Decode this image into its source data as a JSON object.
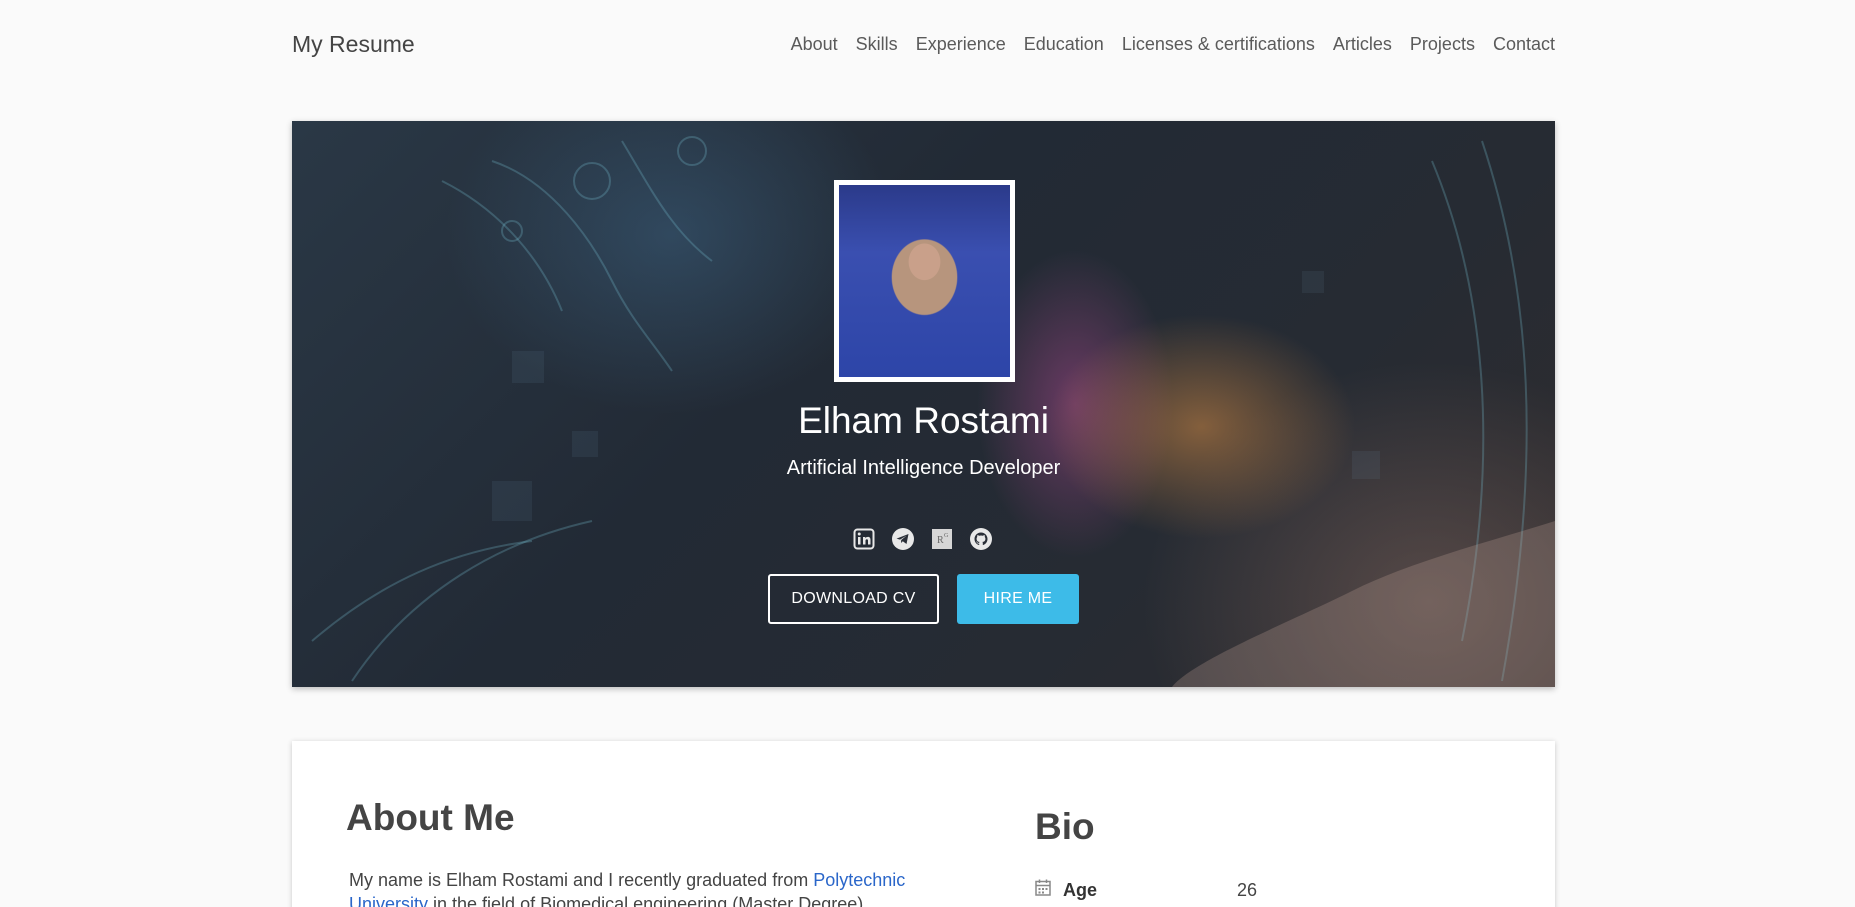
{
  "header": {
    "brand": "My Resume",
    "nav": [
      "About",
      "Skills",
      "Experience",
      "Education",
      "Licenses & certifications",
      "Articles",
      "Projects",
      "Contact"
    ]
  },
  "hero": {
    "name": "Elham Rostami",
    "title": "Artificial Intelligence Developer",
    "socials": [
      "linkedin-icon",
      "telegram-icon",
      "researchgate-icon",
      "github-icon"
    ],
    "download_label": "DOWNLOAD CV",
    "hire_label": "HIRE ME"
  },
  "about": {
    "title": "About Me",
    "text_before": "My name is Elham Rostami and I recently graduated from ",
    "link_text": "Polytechnic University",
    "text_after": " in the field of Biomedical engineering (Master Degree)"
  },
  "bio": {
    "title": "Bio",
    "rows": [
      {
        "label": "Age",
        "value": "26"
      }
    ]
  },
  "colors": {
    "accent": "#3dbbe8",
    "link": "#2a66c9"
  }
}
